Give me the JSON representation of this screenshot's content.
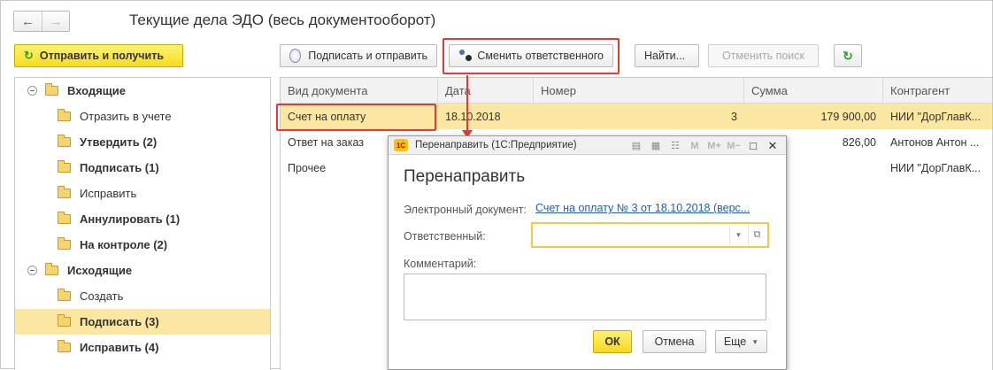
{
  "window": {
    "title": "Текущие дела ЭДО (весь документооборот)"
  },
  "toolbar": {
    "send_receive": "Отправить и получить",
    "sign_send": "Подписать и отправить",
    "change_responsible": "Сменить ответственного",
    "find": "Найти...",
    "cancel_search": "Отменить поиск"
  },
  "tree": {
    "incoming": {
      "label": "Входящие",
      "items": [
        {
          "label": "Отразить в учете"
        },
        {
          "label": "Утвердить (2)"
        },
        {
          "label": "Подписать (1)"
        },
        {
          "label": "Исправить"
        },
        {
          "label": "Аннулировать (1)"
        },
        {
          "label": "На контроле (2)"
        }
      ]
    },
    "outgoing": {
      "label": "Исходящие",
      "items": [
        {
          "label": "Создать"
        },
        {
          "label": "Подписать (3)"
        },
        {
          "label": "Исправить (4)"
        }
      ]
    }
  },
  "table": {
    "columns": [
      "Вид документа",
      "Дата",
      "Номер",
      "Сумма",
      "Контрагент"
    ],
    "rows": [
      {
        "type": "Счет на оплату",
        "date": "18.10.2018",
        "number": "3",
        "sum": "179 900,00",
        "counterparty": "НИИ \"ДорГлавК..."
      },
      {
        "type": "Ответ на заказ",
        "date": "",
        "number": "",
        "sum": "826,00",
        "counterparty": "Антонов Антон ..."
      },
      {
        "type": "Прочее",
        "date": "",
        "number": "",
        "sum": "",
        "counterparty": "НИИ \"ДорГлавК..."
      }
    ]
  },
  "dialog": {
    "window_title": "Перенаправить (1С:Предприятие)",
    "logo_text": "1С",
    "heading": "Перенаправить",
    "doc_label": "Электронный документ:",
    "doc_link": "Счет на оплату № 3  от 18.10.2018 (верс...",
    "responsible_label": "Ответственный:",
    "responsible_value": "",
    "comment_label": "Комментарий:",
    "ok": "ОК",
    "cancel": "Отмена",
    "more": "Еще",
    "toolbar_icons": [
      "document-icon",
      "table-icon",
      "calendar-icon",
      "m-icon",
      "m-plus-icon",
      "m-minus-icon",
      "maximize-icon",
      "close-icon"
    ]
  },
  "colors": {
    "highlight": "#fbe7a2",
    "accent_yellow": "#f5dd1d",
    "callout_red": "#e53935",
    "link": "#1e5fb3"
  }
}
